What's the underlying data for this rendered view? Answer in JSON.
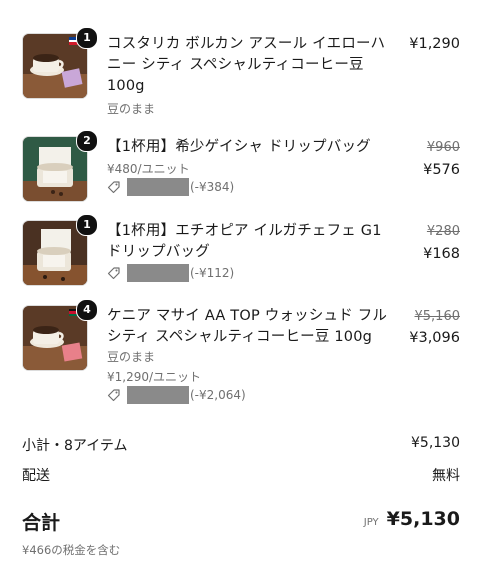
{
  "items": [
    {
      "quantity": "1",
      "title": "コスタリカ ボルカン アスール イエローハニー シティ スペシャルティコーヒー豆 100g",
      "variant": "豆のまま",
      "price": "¥1,290",
      "image": "coffee-cup-icon"
    },
    {
      "quantity": "2",
      "title": "【1杯用】希少ゲイシャ ドリップバッグ",
      "unit_price": "¥480/ユニット",
      "discount": "(-¥384)",
      "original_price": "¥960",
      "price": "¥576",
      "image": "drip-bag-icon"
    },
    {
      "quantity": "1",
      "title": "【1杯用】エチオピア イルガチェフェ G1 ドリップバッグ",
      "discount": "(-¥112)",
      "original_price": "¥280",
      "price": "¥168",
      "image": "drip-bag-icon"
    },
    {
      "quantity": "4",
      "title": "ケニア マサイ AA TOP ウォッシュド フルシティ スペシャルティコーヒー豆 100g",
      "variant": "豆のまま",
      "unit_price": "¥1,290/ユニット",
      "discount": "(-¥2,064)",
      "original_price": "¥5,160",
      "price": "¥3,096",
      "image": "coffee-cup-icon"
    }
  ],
  "summary": {
    "subtotal_label": "小計・8アイテム",
    "subtotal_value": "¥5,130",
    "shipping_label": "配送",
    "shipping_value": "無料",
    "total_label": "合計",
    "currency": "JPY",
    "total_value": "¥5,130",
    "tax_note": "¥466の税金を含む"
  },
  "colors": {
    "text": "#1a1a1a",
    "muted": "#707070",
    "badge": "#111111",
    "redacted": "#8a8a8a"
  }
}
